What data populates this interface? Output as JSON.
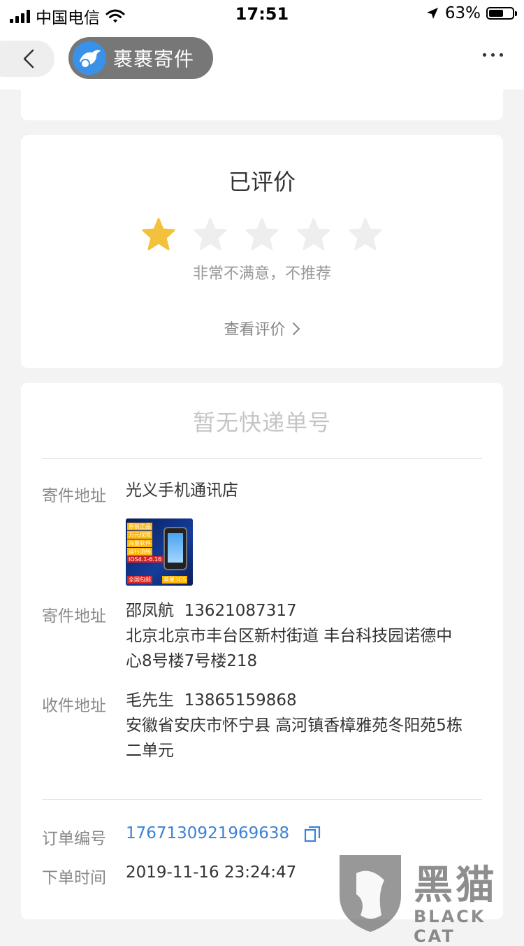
{
  "status_bar": {
    "carrier": "中国电信",
    "time": "17:51",
    "battery": "63%"
  },
  "nav": {
    "app_name": "裹裹寄件"
  },
  "rating": {
    "title": "已评价",
    "stars_total": 5,
    "stars_filled": 1,
    "description": "非常不满意，不推荐",
    "view_link": "查看评价"
  },
  "order": {
    "no_tracking": "暂无快递单号",
    "shop": {
      "label": "寄件地址",
      "value": "光义手机通讯店"
    },
    "product_image_text": [
      "原装正品",
      "万元保障",
      "海量软件",
      "运行流畅",
      "IOS4.1-6.16",
      "全国包邮",
      "苹果3GS"
    ],
    "sender": {
      "label": "寄件地址",
      "name": "邵凤航",
      "phone": "13621087317",
      "address_line1": "北京北京市丰台区新村街道 丰台科技园诺德中",
      "address_line2": "心8号楼7号楼218"
    },
    "receiver": {
      "label": "收件地址",
      "name": "毛先生",
      "phone": "13865159868",
      "address_line1": "安徽省安庆市怀宁县 高河镇香樟雅苑冬阳苑5栋",
      "address_line2": "二单元"
    },
    "order_number": {
      "label": "订单编号",
      "value": "1767130921969638"
    },
    "order_time": {
      "label": "下单时间",
      "value": "2019-11-16 23:24:47"
    }
  },
  "watermark": {
    "title": "黑猫",
    "subtitle": "BLACK CAT"
  },
  "colors": {
    "star_filled": "#f4c13d",
    "star_empty": "#eeeeee",
    "link_blue": "#3b82d8",
    "pill_gray": "#777777"
  }
}
